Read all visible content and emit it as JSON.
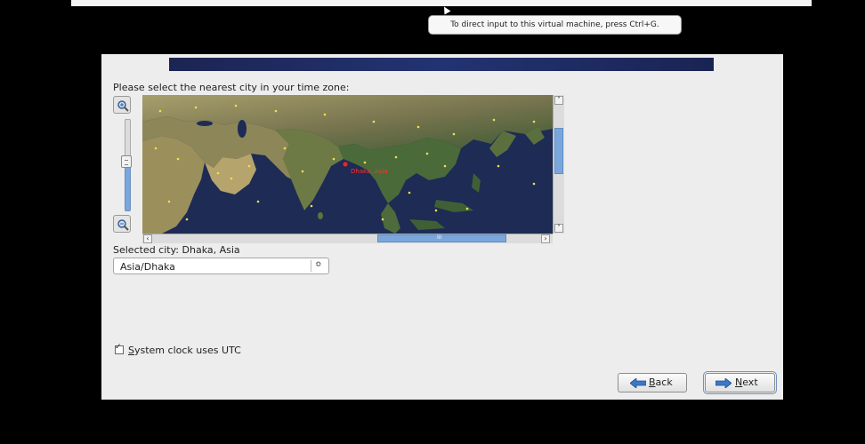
{
  "tooltip": {
    "text": "To direct input to this virtual machine, press Ctrl+G."
  },
  "installer": {
    "prompt": "Please select the nearest city in your time zone:",
    "map": {
      "selected_marker_label": "Dhaka, Asia",
      "hscroll_thumb_glyph": "III"
    },
    "selected_city_label": "Selected city: Dhaka, Asia",
    "timezone_select": {
      "value": "Asia/Dhaka",
      "indicator": "≎"
    },
    "utc_checkbox": {
      "checked": true,
      "accel": "S",
      "rest": "ystem clock uses UTC"
    },
    "buttons": {
      "back": {
        "accel": "B",
        "rest": "ack"
      },
      "next": {
        "accel": "N",
        "rest": "ext"
      }
    }
  }
}
